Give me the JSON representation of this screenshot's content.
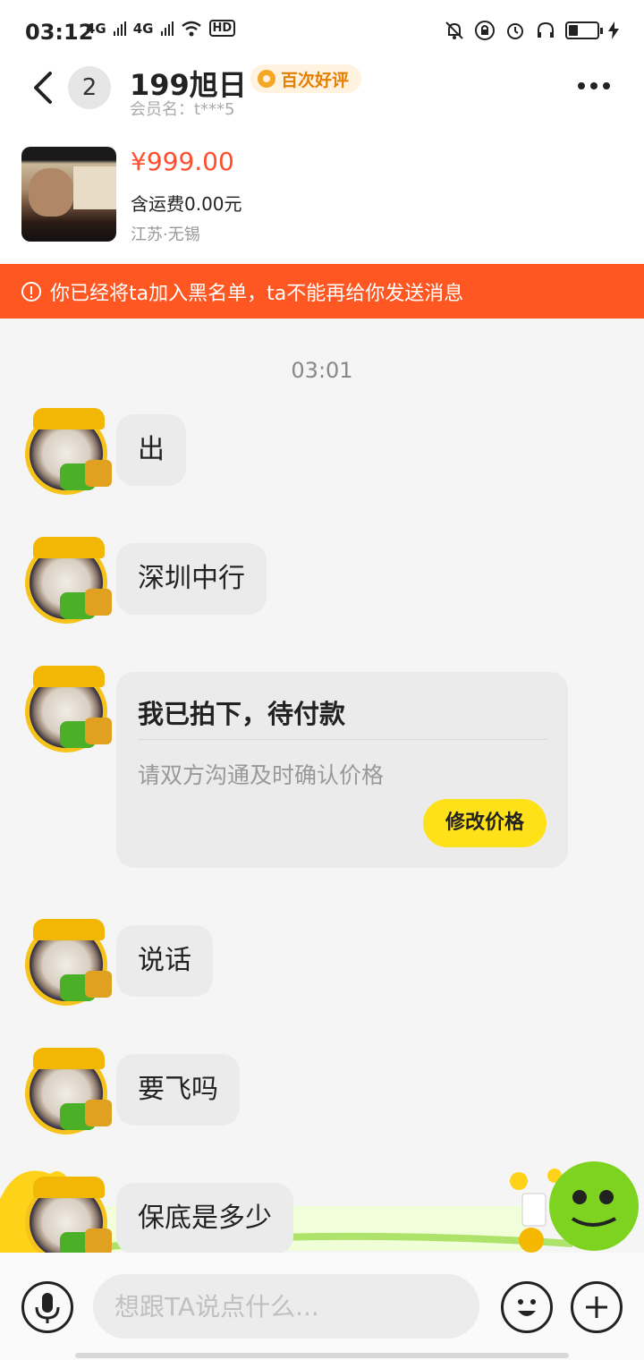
{
  "status_bar": {
    "time": "03:12",
    "left_icons": [
      "4G",
      "4G",
      "HD"
    ],
    "right_icons": [
      "bell-off-icon",
      "lock-rotation-icon",
      "alarm-icon",
      "headphones-icon",
      "battery-icon",
      "charging-icon"
    ]
  },
  "header": {
    "unread_count": "2",
    "seller_name": "199旭日",
    "review_badge": "百次好评",
    "member_label": "会员名：t***5"
  },
  "product": {
    "price": "¥999.00",
    "shipping": "含运费0.00元",
    "location": "江苏·无锡"
  },
  "banner": {
    "text": "你已经将ta加入黑名单，ta不能再给你发送消息"
  },
  "chat": {
    "timestamp": "03:01",
    "messages": [
      {
        "text": "出"
      },
      {
        "text": "深圳中行"
      },
      {
        "text": "说话"
      },
      {
        "text": "要飞吗"
      },
      {
        "text": "保底是多少"
      }
    ],
    "order_card": {
      "title": "我已拍下，待付款",
      "subtitle": "请双方沟通及时确认价格",
      "button": "修改价格"
    }
  },
  "input_bar": {
    "placeholder": "想跟TA说点什么..."
  },
  "colors": {
    "accent_yellow": "#ffe11a",
    "banner_orange": "#ff5722",
    "price_red": "#ff4d2d"
  }
}
